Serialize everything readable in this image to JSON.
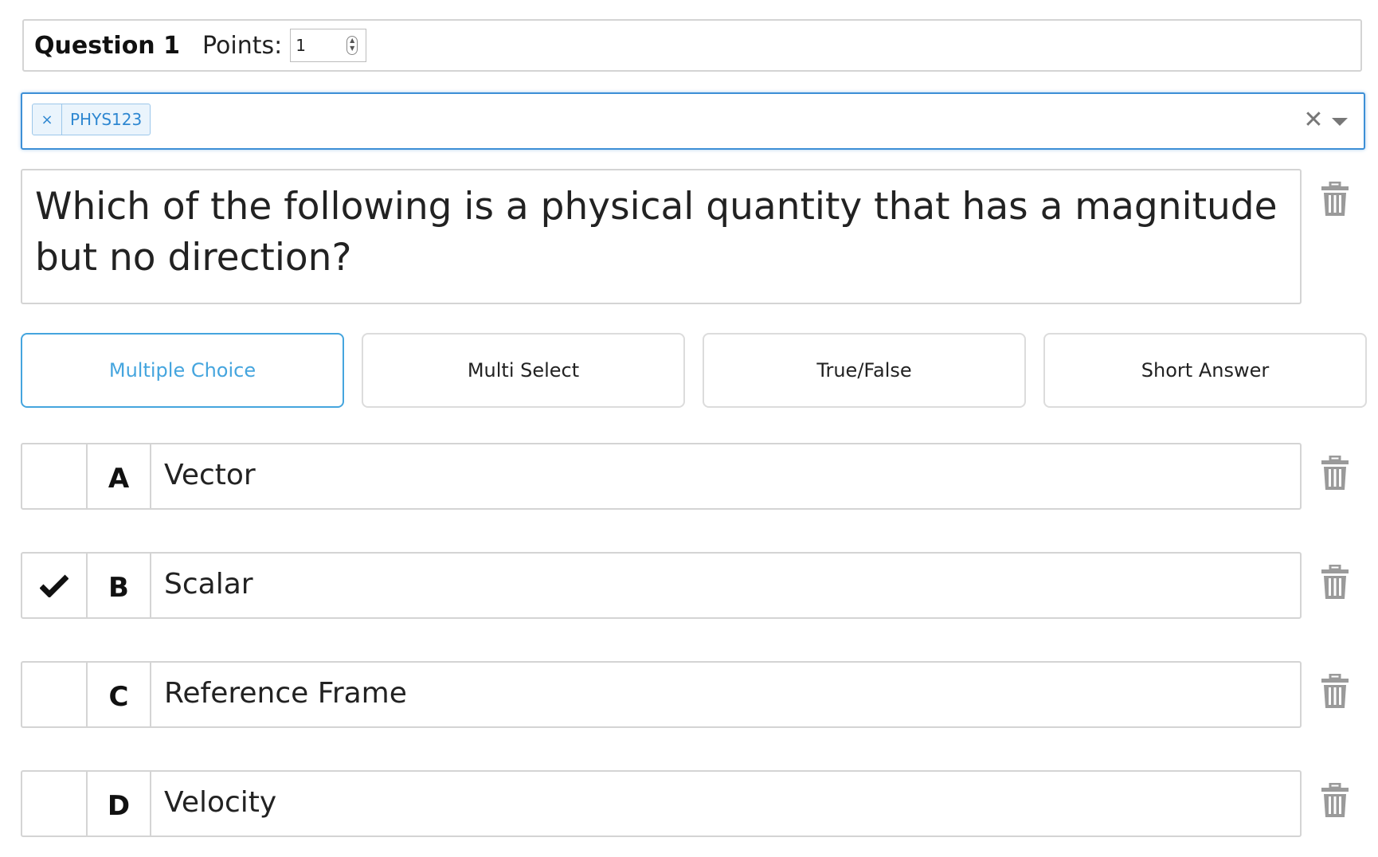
{
  "question": {
    "title": "Question 1",
    "points_label": "Points:",
    "points_value": "1",
    "text": "Which of the following is a physical quantity that has a magnitude but no direction?"
  },
  "tags": {
    "remove_glyph": "×",
    "items": [
      "PHYS123"
    ],
    "clear_glyph": "✕"
  },
  "question_types": {
    "items": [
      "Multiple Choice",
      "Multi Select",
      "True/False",
      "Short Answer"
    ],
    "selected": "Multiple Choice"
  },
  "answers": [
    {
      "letter": "A",
      "text": "Vector",
      "correct": false
    },
    {
      "letter": "B",
      "text": "Scalar",
      "correct": true
    },
    {
      "letter": "C",
      "text": "Reference Frame",
      "correct": false
    },
    {
      "letter": "D",
      "text": "Velocity",
      "correct": false
    }
  ],
  "colors": {
    "accent": "#45a5de",
    "tag_text": "#2e87d1",
    "border": "#d4d4d4",
    "icon_gray": "#9a9a9a"
  },
  "icons": [
    "spinner-icon",
    "close-icon",
    "caret-down-icon",
    "trash-icon",
    "checkmark-icon"
  ]
}
